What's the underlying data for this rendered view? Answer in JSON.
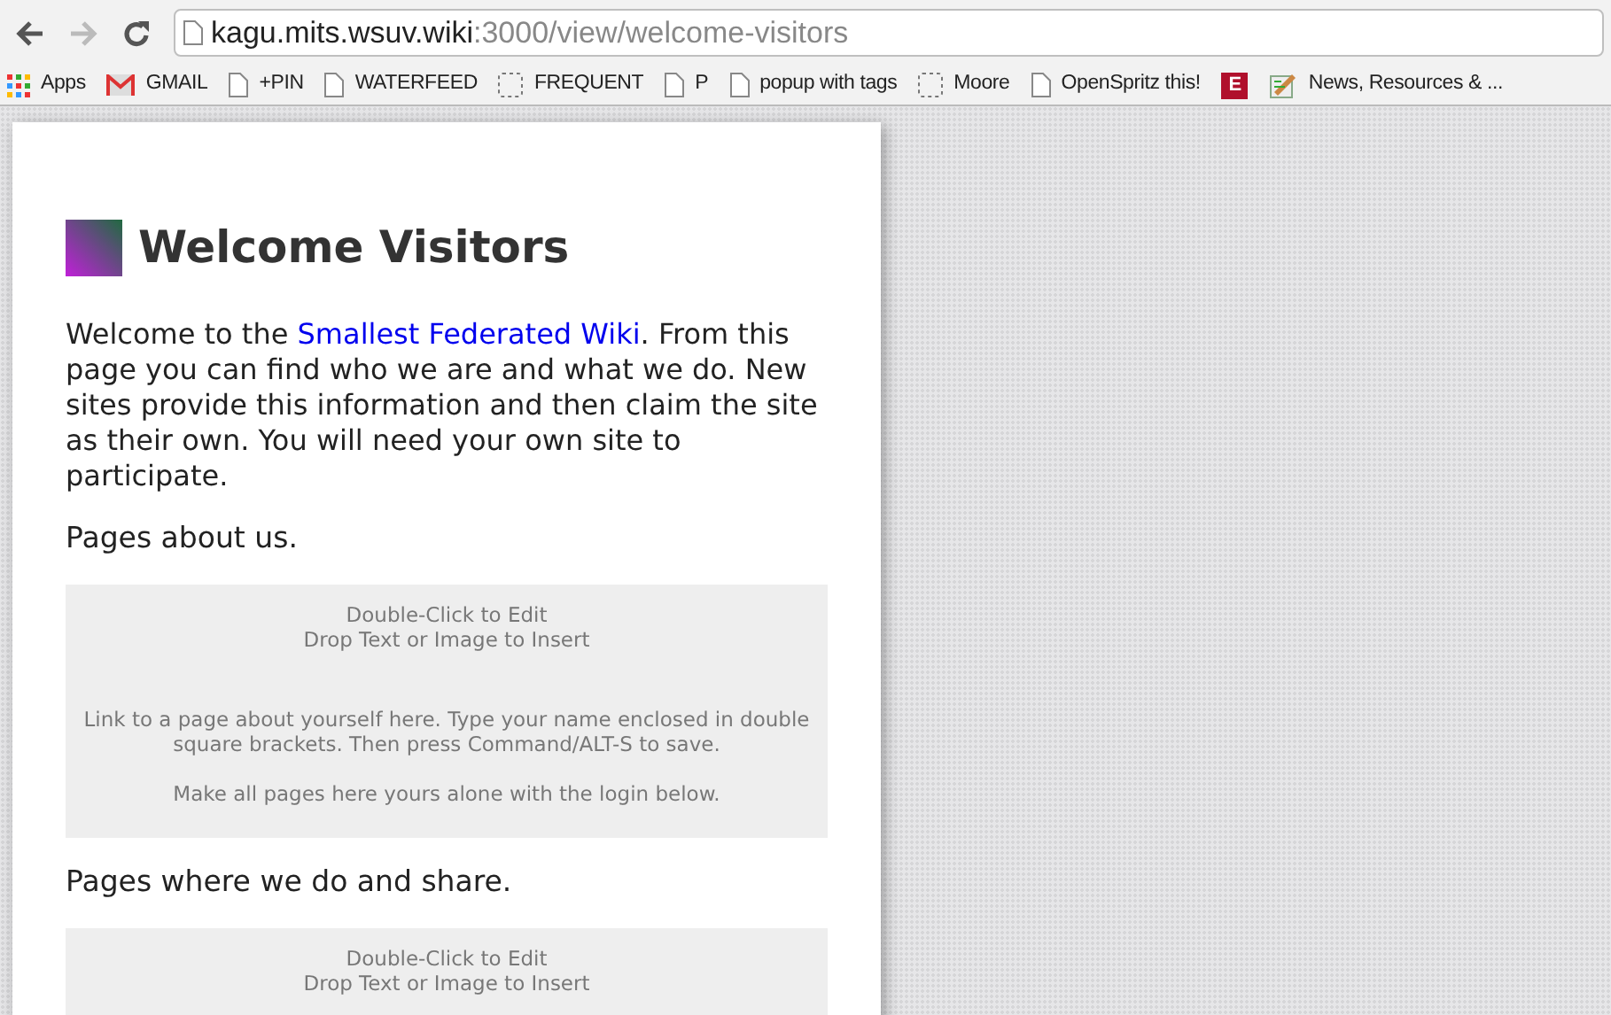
{
  "toolbar": {
    "url_host": "kagu.mits.wsuv.wiki",
    "url_path": ":3000/view/welcome-visitors"
  },
  "bookmarks": [
    {
      "kind": "apps",
      "label": "Apps"
    },
    {
      "kind": "gmail",
      "label": "GMAIL"
    },
    {
      "kind": "page",
      "label": "+PIN"
    },
    {
      "kind": "page",
      "label": "WATERFEED"
    },
    {
      "kind": "folder",
      "label": "FREQUENT"
    },
    {
      "kind": "page",
      "label": "P"
    },
    {
      "kind": "page",
      "label": "popup with tags"
    },
    {
      "kind": "folder",
      "label": "Moore"
    },
    {
      "kind": "page",
      "label": "OpenSpritz this!"
    },
    {
      "kind": "letter",
      "glyph": "E"
    },
    {
      "kind": "news",
      "label": "News, Resources & ..."
    }
  ],
  "page": {
    "title": "Welcome Visitors",
    "intro": {
      "before": "Welcome to the ",
      "link": "Smallest Federated Wiki",
      "after": ". From this page you can find who we are and what we do. New sites provide this information and then claim the site as their own. You will need your own site to participate."
    },
    "sections": [
      {
        "heading": "Pages about us.",
        "factory": {
          "hints": [
            "Double-Click to Edit",
            "Drop Text or Image to Insert"
          ],
          "notes": [
            "Link to a page about yourself here. Type your name enclosed in double square brackets. Then press Command/ALT-S to save.",
            "Make all pages here yours alone with the login below."
          ]
        }
      },
      {
        "heading": "Pages where we do and share.",
        "factory": {
          "hints": [
            "Double-Click to Edit",
            "Drop Text or Image to Insert"
          ]
        }
      }
    ]
  }
}
